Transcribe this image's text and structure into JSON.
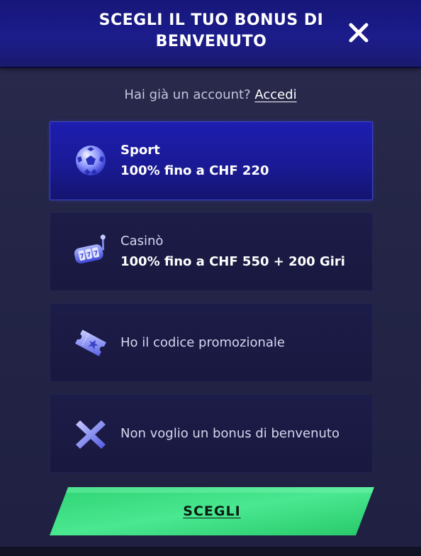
{
  "header": {
    "title": "SCEGLI IL TUO BONUS DI BENVENUTO",
    "close_icon": "close-icon"
  },
  "account": {
    "prompt": "Hai già un account?",
    "login_link": "Accedi"
  },
  "options": [
    {
      "id": "sport",
      "icon": "soccer-ball-icon",
      "title": "Sport",
      "description": "100% fino a CHF 220",
      "selected": true
    },
    {
      "id": "casino",
      "icon": "slot-machine-icon",
      "title": "Casinò",
      "description": "100% fino a CHF 550 + 200 Giri",
      "selected": false
    },
    {
      "id": "promo",
      "icon": "ticket-icon",
      "title": "Ho il codice promozionale",
      "selected": false
    },
    {
      "id": "none",
      "icon": "cross-icon",
      "title": "Non voglio un bonus di benvenuto",
      "selected": false
    }
  ],
  "cta": {
    "label": "SCEGLI"
  },
  "colors": {
    "header_bg": "#1c1c8c",
    "modal_bg": "#242547",
    "selected_option_bg": "#1a1a96",
    "option_bg": "#1a1a44",
    "cta_green": "#3ee68a",
    "accent_blue": "#3d46c8"
  }
}
